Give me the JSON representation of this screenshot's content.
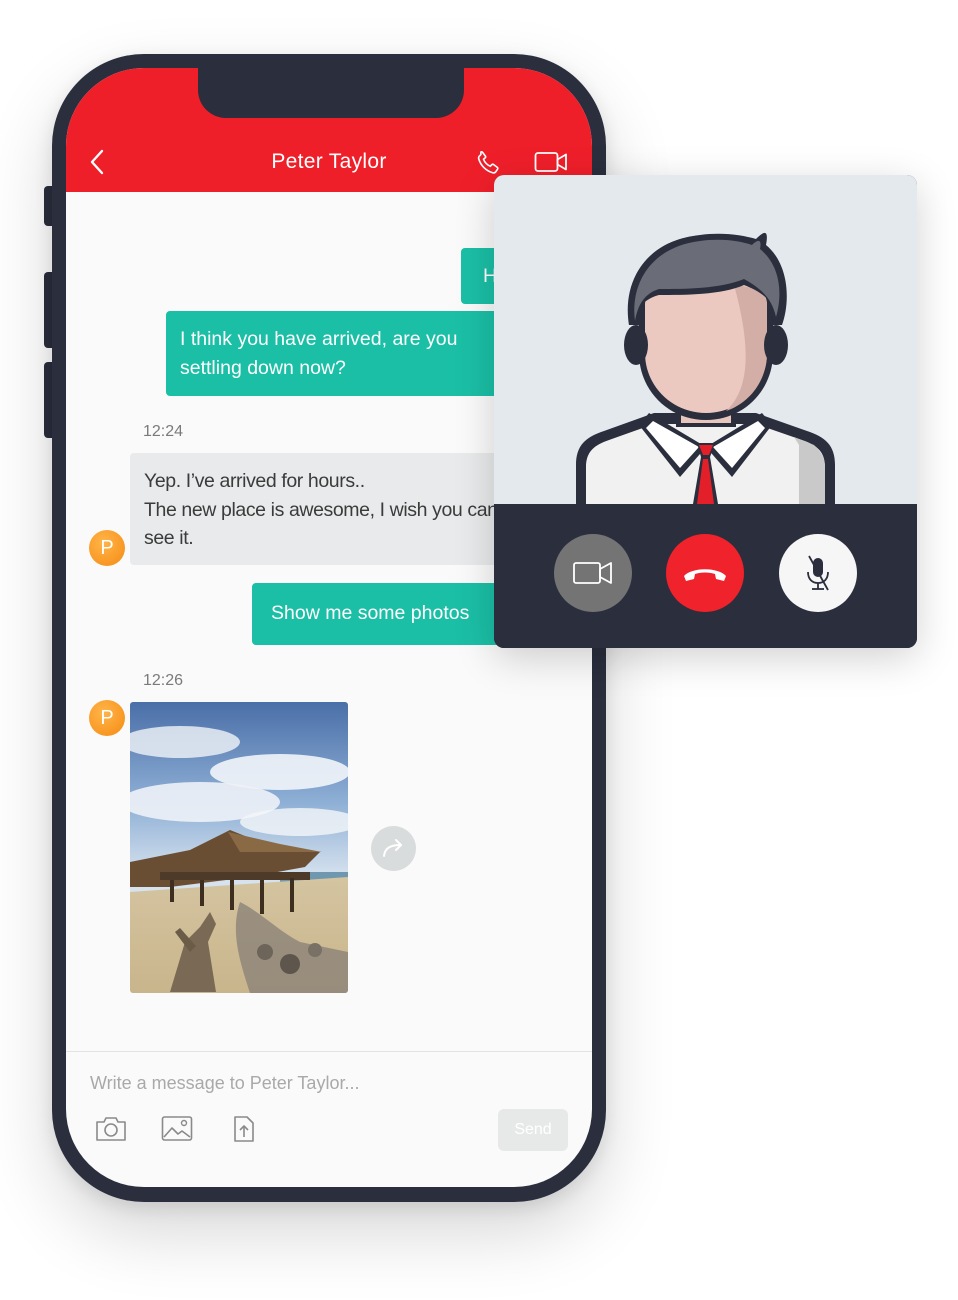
{
  "header": {
    "contact_name": "Peter Taylor",
    "background_color": "#ef1f2a",
    "back_icon": "chevron-left-icon",
    "call_icon": "phone-icon",
    "video_icon": "video-camera-icon"
  },
  "messages": [
    {
      "direction": "outgoing",
      "text": "H",
      "color": "#1bbfa6"
    },
    {
      "direction": "outgoing",
      "text": "I think you have arrived, are you settling down now?",
      "color": "#1bbfa6"
    },
    {
      "direction": "incoming",
      "time": "12:24",
      "sender_initial": "P",
      "lines": [
        "Yep. I’ve arrived for hours..",
        "The new place is awesome, I wish you can",
        "see it."
      ],
      "color": "#e8eaeb"
    },
    {
      "direction": "outgoing",
      "text": "Show me some photos",
      "color": "#1bbfa6"
    },
    {
      "direction": "incoming",
      "time": "12:26",
      "sender_initial": "P",
      "type": "photo",
      "image": "beach-pier-photo"
    }
  ],
  "share_icon": "share-arrow-icon",
  "composer": {
    "placeholder": "Write a message to Peter Taylor...",
    "value": "",
    "tools": [
      "camera-icon",
      "image-icon",
      "upload-icon"
    ],
    "send_label": "Send"
  },
  "video_call": {
    "caller_avatar": "businessman-avatar-icon",
    "controls": [
      {
        "name": "toggle-video-button",
        "icon": "video-camera-icon",
        "color": "#747474"
      },
      {
        "name": "end-call-button",
        "icon": "hang-up-icon",
        "color": "#f0222b"
      },
      {
        "name": "mute-button",
        "icon": "microphone-off-icon",
        "color": "#f6f6f6"
      }
    ]
  }
}
